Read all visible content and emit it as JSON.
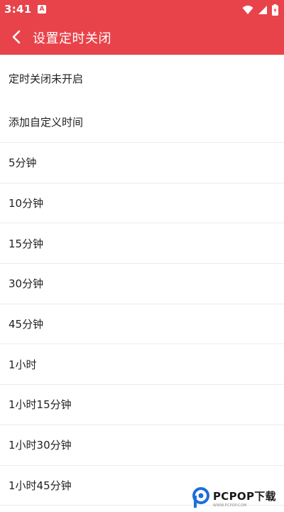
{
  "status_bar": {
    "time": "3:41",
    "notification_glyph": "A",
    "icons": [
      "wifi-icon",
      "signal-icon",
      "battery-icon"
    ]
  },
  "app_bar": {
    "title": "设置定时关闭",
    "back_icon": "chevron-left-icon"
  },
  "timer_options": [
    "定时关闭未开启",
    "添加自定义时间",
    "5分钟",
    "10分钟",
    "15分钟",
    "30分钟",
    "45分钟",
    "1小时",
    "1小时15分钟",
    "1小时30分钟",
    "1小时45分钟"
  ],
  "watermark": {
    "brand": "PCPOP下载",
    "sub": "WWW.PCPOP.COM"
  },
  "colors": {
    "accent": "#e8434a",
    "text": "#222222",
    "divider": "#ececec"
  }
}
